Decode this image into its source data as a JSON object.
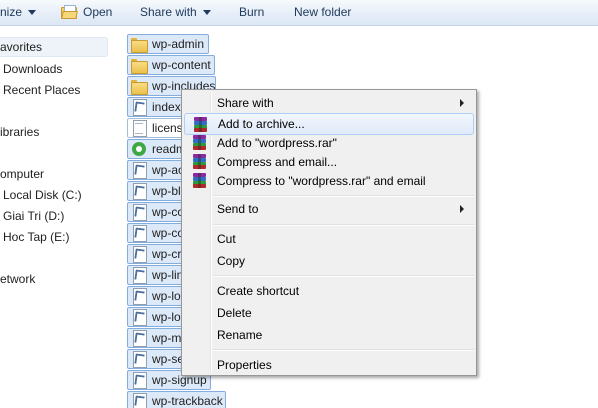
{
  "toolbar": {
    "organize_label": "nize",
    "open_label": "Open",
    "share_with_label": "Share with",
    "burn_label": "Burn",
    "new_folder_label": "New folder"
  },
  "nav": {
    "favorites": "avorites",
    "downloads": "Downloads",
    "recent_places": "Recent Places",
    "libraries": "ibraries",
    "computer": "omputer",
    "local_disk": "Local Disk (C:)",
    "giai_tri": "Giai Tri (D:)",
    "hoc_tap": "Hoc Tap (E:)",
    "network": "etwork"
  },
  "files": [
    {
      "name": "wp-admin",
      "icon": "folder-icon"
    },
    {
      "name": "wp-content",
      "icon": "folder-icon"
    },
    {
      "name": "wp-includes",
      "icon": "folder-icon"
    },
    {
      "name": "index",
      "icon": "php-file-icon"
    },
    {
      "name": "license",
      "icon": "text-file-icon"
    },
    {
      "name": "readme",
      "icon": "html-file-icon"
    },
    {
      "name": "wp-activate",
      "icon": "php-file-icon"
    },
    {
      "name": "wp-blog-header",
      "icon": "php-file-icon"
    },
    {
      "name": "wp-comments-post",
      "icon": "php-file-icon"
    },
    {
      "name": "wp-config-sample",
      "icon": "php-file-icon"
    },
    {
      "name": "wp-cron",
      "icon": "php-file-icon"
    },
    {
      "name": "wp-links-opml",
      "icon": "php-file-icon"
    },
    {
      "name": "wp-load",
      "icon": "php-file-icon"
    },
    {
      "name": "wp-login",
      "icon": "php-file-icon"
    },
    {
      "name": "wp-mail",
      "icon": "php-file-icon"
    },
    {
      "name": "wp-settings",
      "icon": "php-file-icon"
    },
    {
      "name": "wp-signup",
      "icon": "php-file-icon"
    },
    {
      "name": "wp-trackback",
      "icon": "php-file-icon"
    }
  ],
  "menu": {
    "share_with": "Share with",
    "add_to_archive": "Add to archive...",
    "add_to_rar": "Add to \"wordpress.rar\"",
    "compress_email": "Compress and email...",
    "compress_rar_email": "Compress to \"wordpress.rar\" and email",
    "send_to": "Send to",
    "cut": "Cut",
    "copy": "Copy",
    "create_shortcut": "Create shortcut",
    "delete": "Delete",
    "rename": "Rename",
    "properties": "Properties"
  },
  "colors": {
    "selection_fill": "#dce9f8",
    "selection_border": "#84acdd",
    "menu_background": "#f0f0f0",
    "menu_highlight_border": "#aecff7"
  }
}
